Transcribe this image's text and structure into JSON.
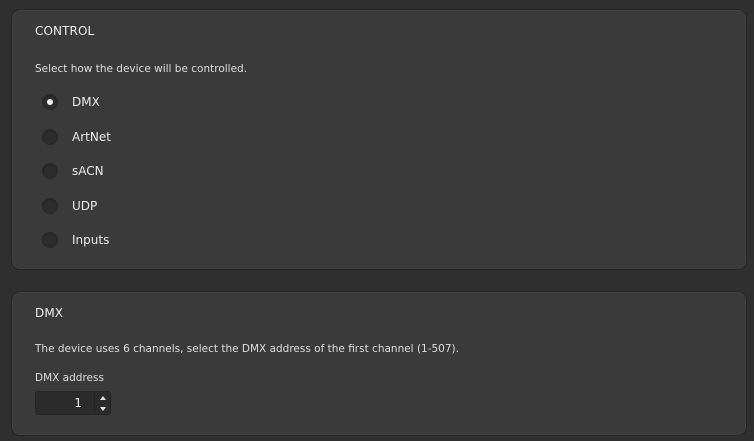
{
  "control": {
    "title": "CONTROL",
    "description": "Select how the device will be controlled.",
    "options": [
      {
        "label": "DMX",
        "checked": true
      },
      {
        "label": "ArtNet",
        "checked": false
      },
      {
        "label": "sACN",
        "checked": false
      },
      {
        "label": "UDP",
        "checked": false
      },
      {
        "label": "Inputs",
        "checked": false
      }
    ]
  },
  "dmx": {
    "title": "DMX",
    "description": "The device uses 6 channels, select the DMX address of the first channel (1-507).",
    "address_label": "DMX address",
    "address_value": "1"
  }
}
